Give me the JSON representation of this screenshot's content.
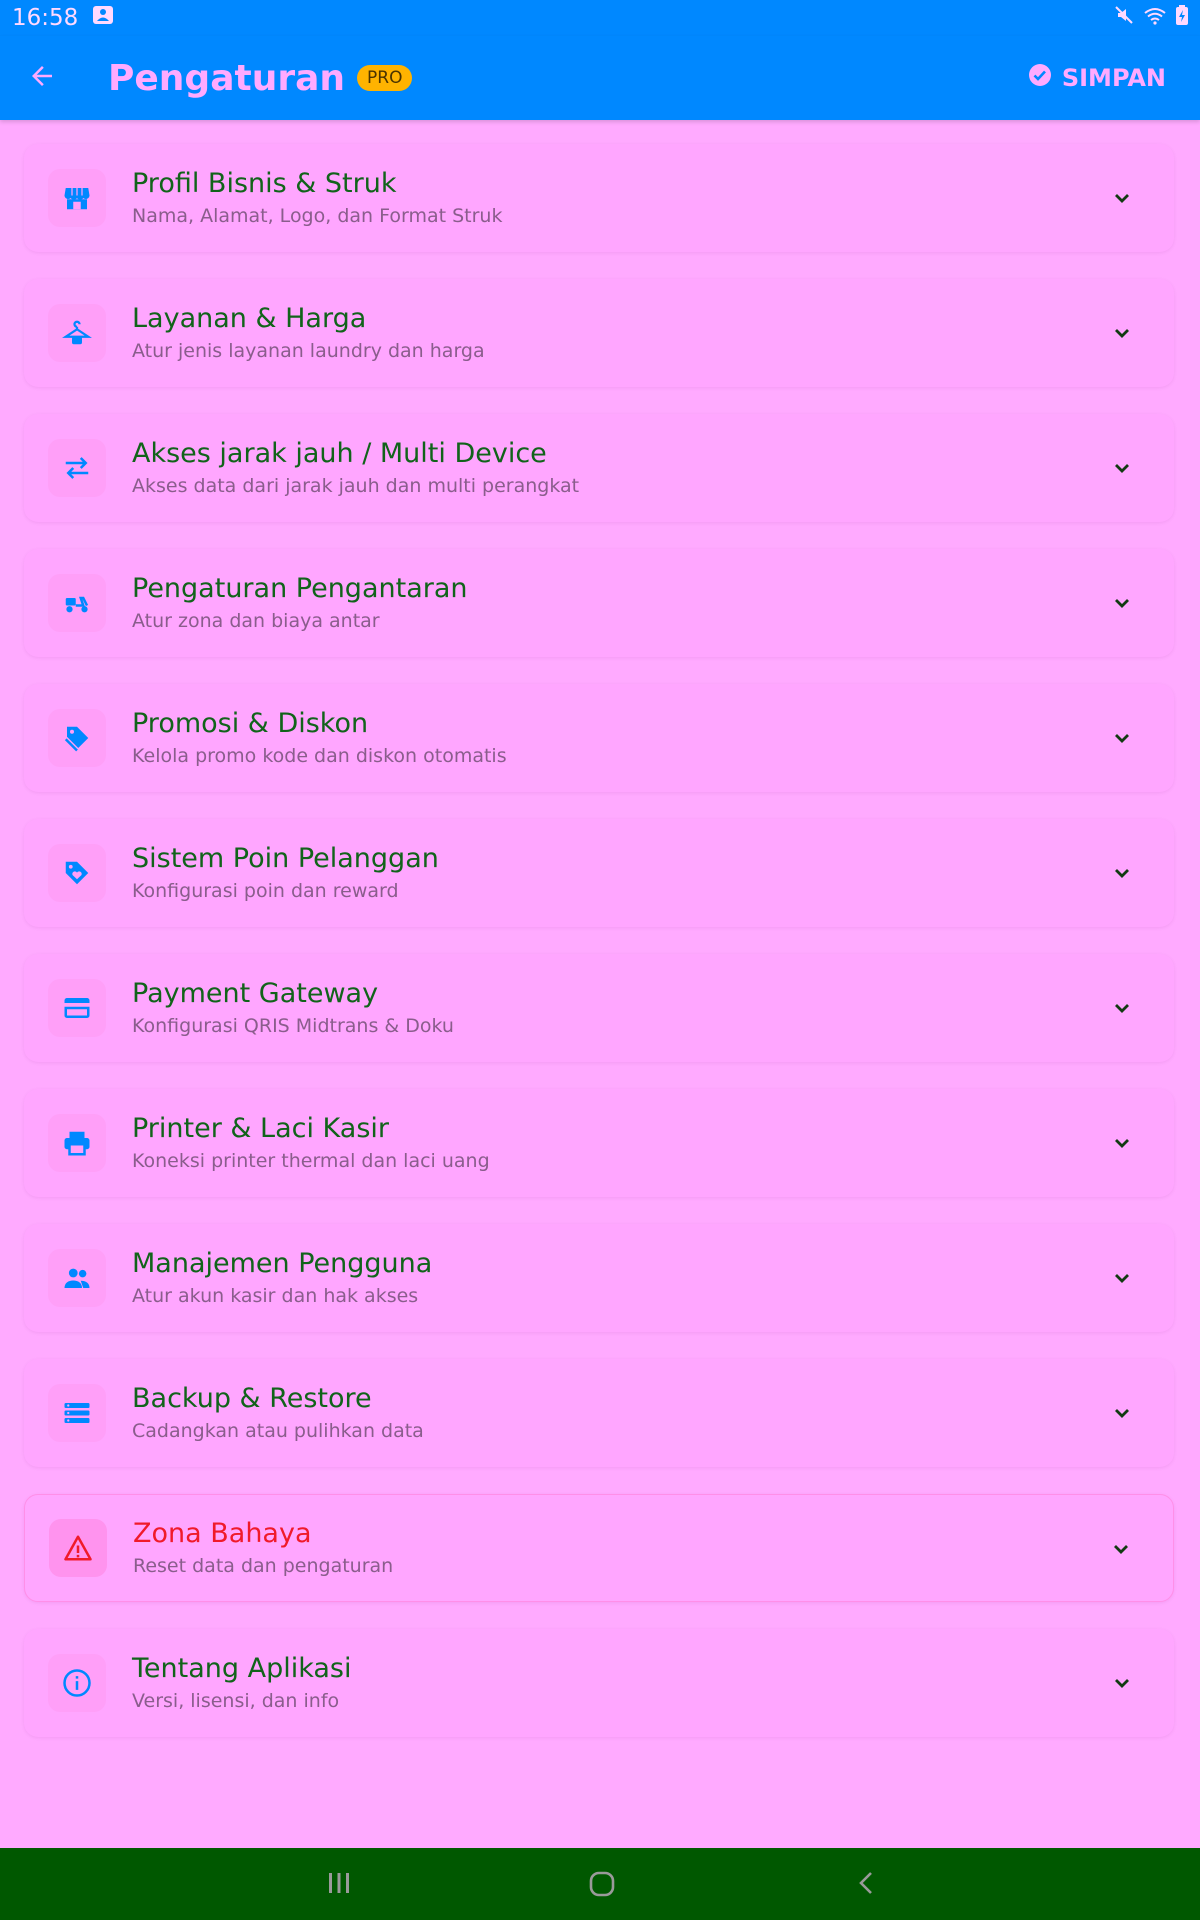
{
  "status_bar": {
    "time": "16:58",
    "icons": [
      "notification-icon",
      "mute-icon",
      "wifi-icon",
      "battery-icon"
    ]
  },
  "app_bar": {
    "title": "Pengaturan",
    "badge": "PRO",
    "save_label": "SIMPAN"
  },
  "colors": {
    "primary": "#0088ff",
    "background": "#ffaaff",
    "title_green": "#11631a",
    "danger_red": "#f01a2a",
    "badge": "#ffb300",
    "nav_bar": "#005800"
  },
  "sections": [
    {
      "icon": "storefront-icon",
      "title": "Profil Bisnis & Struk",
      "subtitle": "Nama, Alamat, Logo, dan Format Struk"
    },
    {
      "icon": "hanger-icon",
      "title": "Layanan & Harga",
      "subtitle": "Atur jenis layanan laundry dan harga"
    },
    {
      "icon": "swap-arrows-icon",
      "title": "Akses jarak jauh / Multi Device",
      "subtitle": "Akses data dari jarak jauh dan multi perangkat"
    },
    {
      "icon": "delivery-scooter-icon",
      "title": "Pengaturan Pengantaran",
      "subtitle": "Atur zona dan biaya antar"
    },
    {
      "icon": "tags-icon",
      "title": "Promosi & Diskon",
      "subtitle": "Kelola promo kode dan diskon otomatis"
    },
    {
      "icon": "loyalty-tag-icon",
      "title": "Sistem Poin Pelanggan",
      "subtitle": "Konfigurasi poin dan reward"
    },
    {
      "icon": "credit-card-icon",
      "title": "Payment Gateway",
      "subtitle": "Konfigurasi QRIS Midtrans & Doku"
    },
    {
      "icon": "printer-icon",
      "title": "Printer & Laci Kasir",
      "subtitle": "Koneksi printer thermal dan laci uang"
    },
    {
      "icon": "people-icon",
      "title": "Manajemen Pengguna",
      "subtitle": "Atur akun kasir dan hak akses"
    },
    {
      "icon": "storage-icon",
      "title": "Backup & Restore",
      "subtitle": "Cadangkan atau pulihkan data"
    },
    {
      "icon": "warning-icon",
      "title": "Zona Bahaya",
      "subtitle": "Reset data dan pengaturan"
    },
    {
      "icon": "info-icon",
      "title": "Tentang Aplikasi",
      "subtitle": "Versi, lisensi, dan info"
    }
  ],
  "nav_bar": {
    "items": [
      "recent-apps-icon",
      "home-icon",
      "back-nav-icon"
    ]
  }
}
